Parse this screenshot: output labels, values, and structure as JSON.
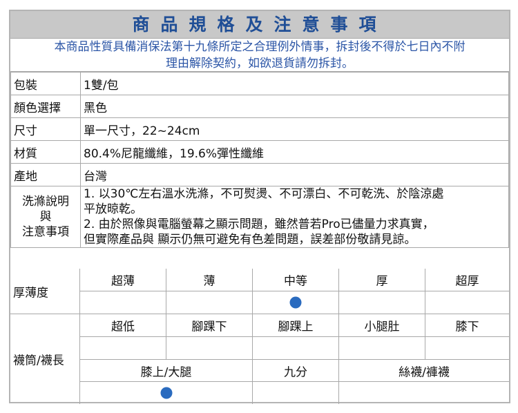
{
  "title": "商品規格及注意事項",
  "notice": {
    "line1": "本商品性質具備消保法第十九條所定之合理例外情事，拆封後不得於七日內不附",
    "line2": "理由解除契約，如欲退貨請勿拆封。"
  },
  "specs": [
    {
      "key": "包裝",
      "value": "1雙/包"
    },
    {
      "key": "顏色選擇",
      "value": "黑色"
    },
    {
      "key": "尺寸",
      "value": "單一尺寸，22~24cm"
    },
    {
      "key": "材質",
      "value": "80.4%尼龍纖維，19.6%彈性纖維"
    },
    {
      "key": "產地",
      "value": "台灣"
    }
  ],
  "care": {
    "key_line1": "洗滌說明",
    "key_line2": "與",
    "key_line3": "注意事項",
    "line1": "1. 以30℃左右溫水洗滌，不可熨燙、不可漂白、不可乾洗、於陰涼處",
    "line2": "平放晾乾。",
    "line3": "2. 由於照像與電腦螢幕之顯示問題，雖然普若Pro已儘量力求真實，",
    "line4": "但實際產品與 顯示仍無可避免有色差問題，誤差部份敬請見諒。"
  },
  "thickness": {
    "label": "厚薄度",
    "options": [
      "超薄",
      "薄",
      "中等",
      "厚",
      "超厚"
    ],
    "selected": "中等"
  },
  "length": {
    "label": "襪筒/襪長",
    "options_row1": [
      "超低",
      "腳踝下",
      "腳踝上",
      "小腿肚",
      "膝下"
    ],
    "options_row2": [
      "膝上/大腿",
      "九分",
      "絲襪/褲襪"
    ],
    "selected": "膝上/大腿"
  },
  "colors": {
    "title_text": "#1f4e96",
    "title_bg": "#c8c8c8",
    "notice_text": "#2b55a6",
    "dot": "#2a6bbf",
    "border": "#a8a8a8"
  }
}
